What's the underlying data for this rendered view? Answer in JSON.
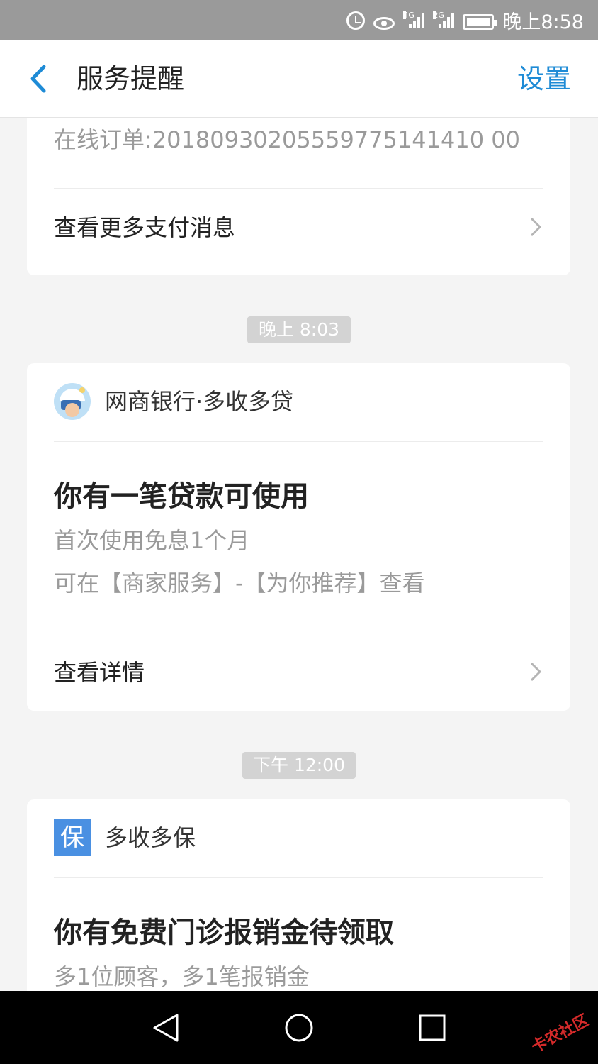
{
  "status_bar": {
    "net_tag_1": "4G",
    "net_tag_2": "2G",
    "time": "晚上8:58",
    "icons": [
      "alarm-icon",
      "eye-comfort-icon",
      "signal-4g-icon",
      "signal-2g-icon",
      "battery-charging-icon"
    ]
  },
  "header": {
    "title": "服务提醒",
    "settings_label": "设置",
    "accent_color": "#1e8bd6"
  },
  "messages": [
    {
      "order_text": "在线订单:20180930205559775141410 00",
      "more_label": "查看更多支付消息"
    },
    {
      "time": "晚上 8:03",
      "sender": "网商银行·多收多贷",
      "title": "你有一笔贷款可使用",
      "line1": "首次使用免息1个月",
      "line2": "可在【商家服务】-【为你推荐】查看",
      "action": "查看详情"
    },
    {
      "time": "下午 12:00",
      "sender": "多收多保",
      "logo_char": "保",
      "title": "你有免费门诊报销金待领取",
      "line1": "多1位顾客，多1笔报销金"
    }
  ],
  "watermark": "卡农社区"
}
